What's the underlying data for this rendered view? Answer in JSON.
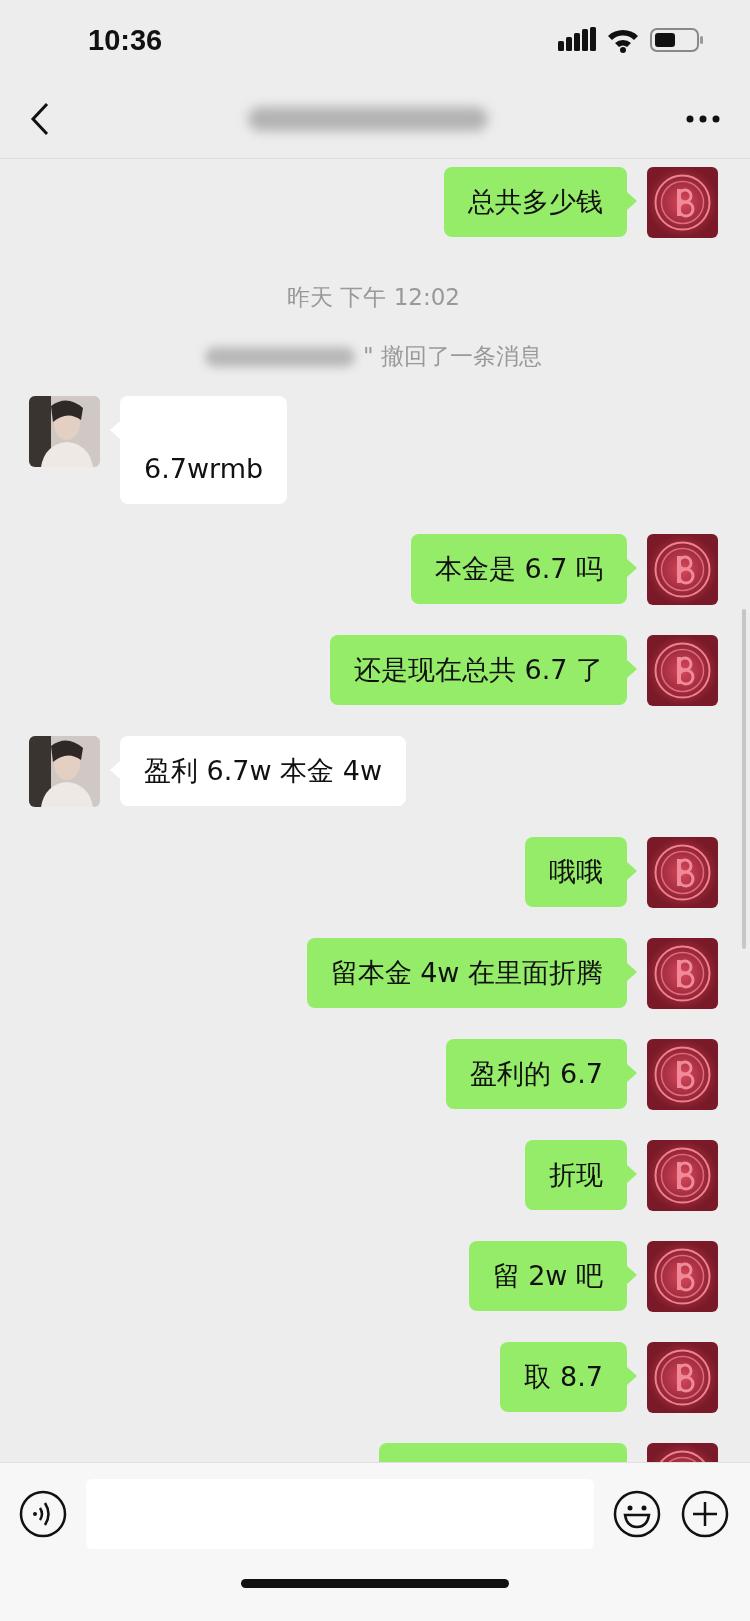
{
  "status_bar": {
    "time": "10:36"
  },
  "chat": {
    "items": [
      {
        "kind": "sent",
        "text": "总共多少钱"
      },
      {
        "kind": "time",
        "text": "昨天 下午 12:02"
      },
      {
        "kind": "recall",
        "text": "\" 撤回了一条消息"
      },
      {
        "kind": "received",
        "text": "\n6.7wrmb"
      },
      {
        "kind": "sent",
        "text": "本金是 6.7 吗"
      },
      {
        "kind": "sent",
        "text": "还是现在总共 6.7 了"
      },
      {
        "kind": "received",
        "text": "盈利 6.7w 本金 4w"
      },
      {
        "kind": "sent",
        "text": "哦哦"
      },
      {
        "kind": "sent",
        "text": "留本金 4w 在里面折腾"
      },
      {
        "kind": "sent",
        "text": "盈利的 6.7"
      },
      {
        "kind": "sent",
        "text": "折现"
      },
      {
        "kind": "sent",
        "text": "留 2w 吧"
      },
      {
        "kind": "sent",
        "text": "取 8.7"
      },
      {
        "kind": "sent_partial"
      }
    ]
  }
}
